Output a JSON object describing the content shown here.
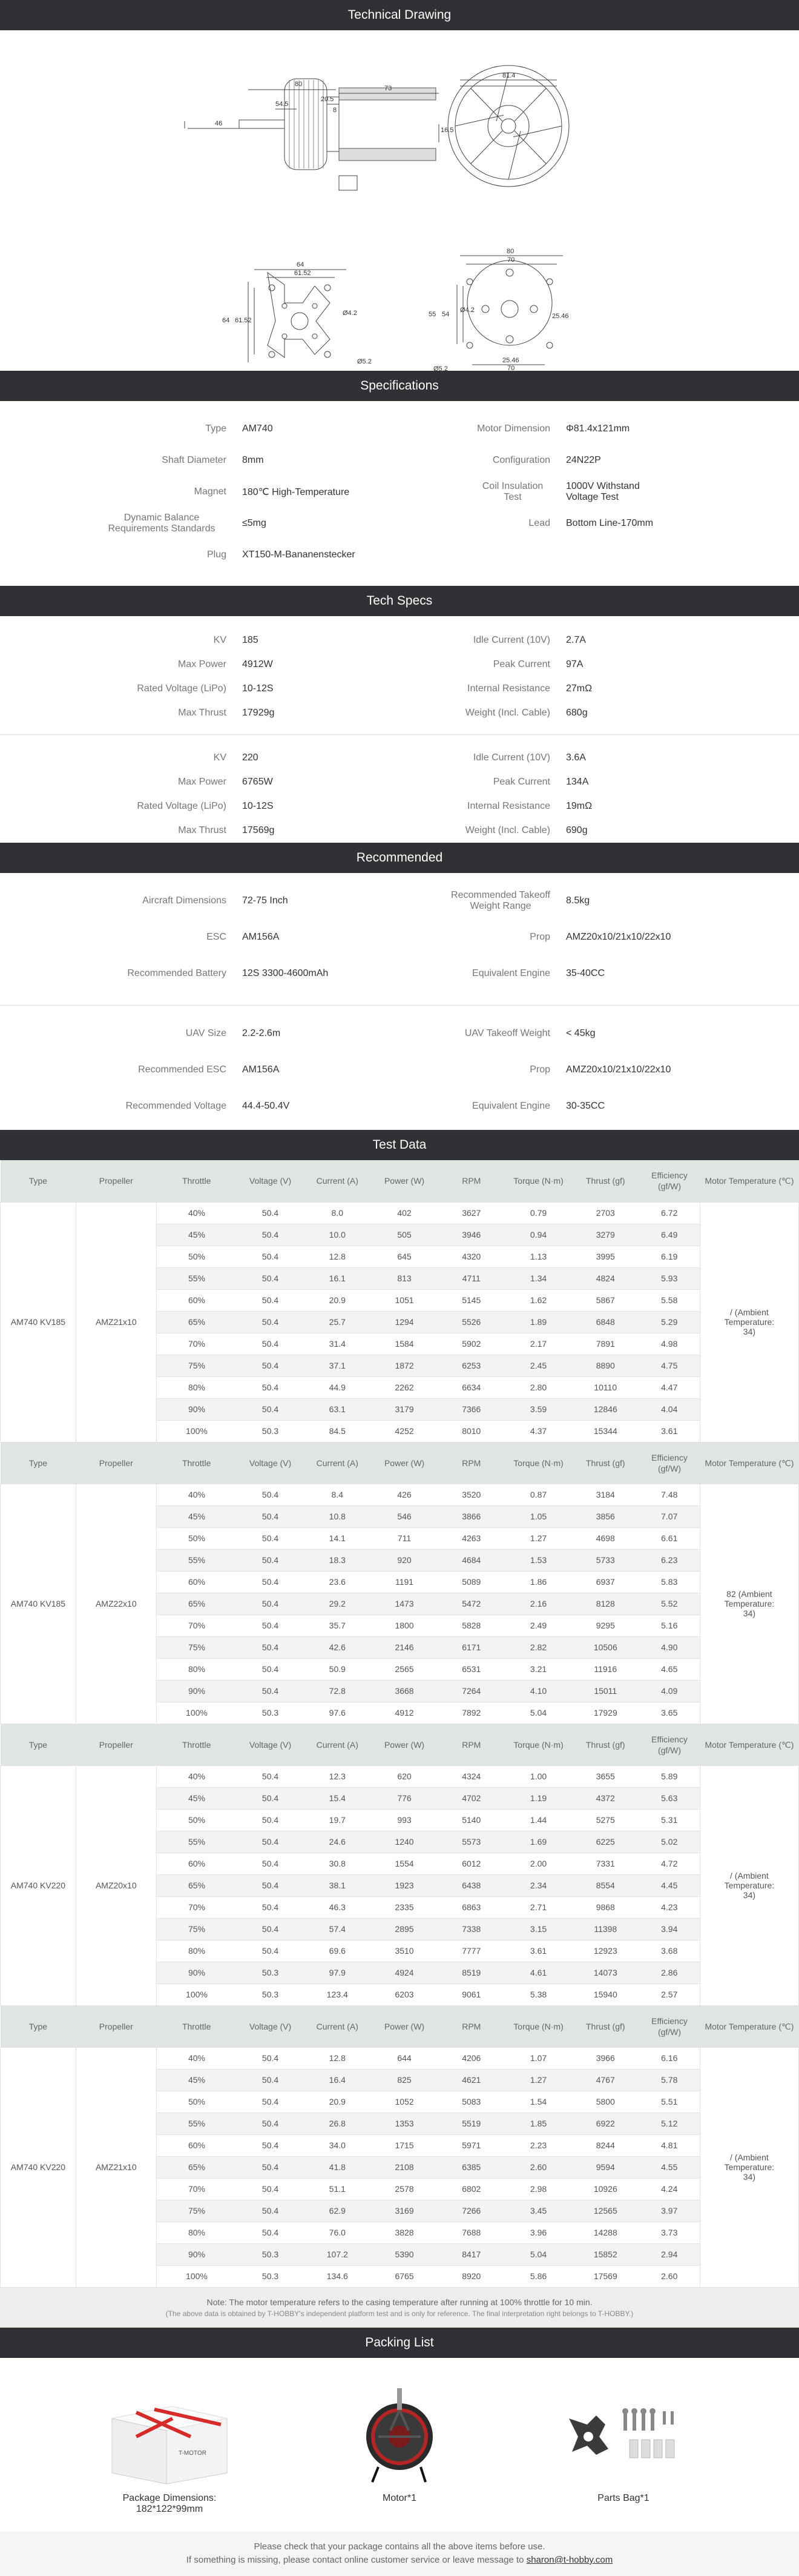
{
  "sections": {
    "technical_drawing": "Technical Drawing",
    "specifications": "Specifications",
    "tech_specs": "Tech Specs",
    "recommended": "Recommended",
    "test_data": "Test Data",
    "packing_list": "Packing List"
  },
  "drawing": {
    "dims": [
      "80",
      "73",
      "54.5",
      "20.5",
      "8",
      "46",
      "16.5",
      "81.4",
      "64",
      "61.52",
      "64",
      "61.52",
      "Ø4.2",
      "Ø5.2",
      "80",
      "70",
      "55",
      "54",
      "Ø4.2",
      "25.46",
      "25.46",
      "70",
      "Ø5.2"
    ]
  },
  "specs": {
    "left": [
      {
        "k": "Type",
        "v": "AM740"
      },
      {
        "k": "Shaft Diameter",
        "v": "8mm"
      },
      {
        "k": "Magnet",
        "v": "180℃ High-Temperature"
      },
      {
        "k": "Dynamic Balance Requirements Standards",
        "v": "≤5mg"
      },
      {
        "k": "Plug",
        "v": "XT150-M-Bananenstecker"
      }
    ],
    "right": [
      {
        "k": "Motor Dimension",
        "v": "Φ81.4x121mm"
      },
      {
        "k": "Configuration",
        "v": "24N22P"
      },
      {
        "k": "Coil Insulation Test",
        "v": "1000V Withstand Voltage Test"
      },
      {
        "k": "Lead",
        "v": "Bottom Line-170mm"
      }
    ]
  },
  "tech_specs": [
    {
      "left": [
        [
          "KV",
          "185"
        ],
        [
          "Max Power",
          "4912W"
        ],
        [
          "Rated Voltage (LiPo)",
          "10-12S"
        ],
        [
          "Max Thrust",
          "17929g"
        ]
      ],
      "right": [
        [
          "Idle Current (10V)",
          "2.7A"
        ],
        [
          "Peak Current",
          "97A"
        ],
        [
          "Internal Resistance",
          "27mΩ"
        ],
        [
          "Weight (Incl. Cable)",
          "680g"
        ]
      ]
    },
    {
      "left": [
        [
          "KV",
          "220"
        ],
        [
          "Max Power",
          "6765W"
        ],
        [
          "Rated Voltage (LiPo)",
          "10-12S"
        ],
        [
          "Max Thrust",
          "17569g"
        ]
      ],
      "right": [
        [
          "Idle Current (10V)",
          "3.6A"
        ],
        [
          "Peak Current",
          "134A"
        ],
        [
          "Internal Resistance",
          "19mΩ"
        ],
        [
          "Weight (Incl. Cable)",
          "690g"
        ]
      ]
    }
  ],
  "recommended": [
    {
      "left": [
        [
          "Aircraft Dimensions",
          "72-75 Inch"
        ],
        [
          "ESC",
          "AM156A"
        ],
        [
          "Recommended Battery",
          "12S 3300-4600mAh"
        ]
      ],
      "right": [
        [
          "Recommended Takeoff Weight Range",
          "8.5kg"
        ],
        [
          "Prop",
          "AMZ20x10/21x10/22x10"
        ],
        [
          "Equivalent Engine",
          "35-40CC"
        ]
      ]
    },
    {
      "left": [
        [
          "UAV Size",
          "2.2-2.6m"
        ],
        [
          "Recommended ESC",
          "AM156A"
        ],
        [
          "Recommended Voltage",
          "44.4-50.4V"
        ]
      ],
      "right": [
        [
          "UAV Takeoff Weight",
          "< 45kg"
        ],
        [
          "Prop",
          "AMZ20x10/21x10/22x10"
        ],
        [
          "Equivalent Engine",
          "30-35CC"
        ]
      ]
    }
  ],
  "test_headers": [
    "Type",
    "Propeller",
    "Throttle",
    "Voltage (V)",
    "Current (A)",
    "Power (W)",
    "RPM",
    "Torque (N·m)",
    "Thrust (gf)",
    "Efficiency (gf/W)",
    "Motor Temperature (℃)"
  ],
  "test_blocks": [
    {
      "type": "AM740 KV185",
      "prop": "AMZ21x10",
      "temp": "/ (Ambient Temperature: 34)",
      "rows": [
        [
          "40%",
          "50.4",
          "8.0",
          "402",
          "3627",
          "0.79",
          "2703",
          "6.72"
        ],
        [
          "45%",
          "50.4",
          "10.0",
          "505",
          "3946",
          "0.94",
          "3279",
          "6.49"
        ],
        [
          "50%",
          "50.4",
          "12.8",
          "645",
          "4320",
          "1.13",
          "3995",
          "6.19"
        ],
        [
          "55%",
          "50.4",
          "16.1",
          "813",
          "4711",
          "1.34",
          "4824",
          "5.93"
        ],
        [
          "60%",
          "50.4",
          "20.9",
          "1051",
          "5145",
          "1.62",
          "5867",
          "5.58"
        ],
        [
          "65%",
          "50.4",
          "25.7",
          "1294",
          "5526",
          "1.89",
          "6848",
          "5.29"
        ],
        [
          "70%",
          "50.4",
          "31.4",
          "1584",
          "5902",
          "2.17",
          "7891",
          "4.98"
        ],
        [
          "75%",
          "50.4",
          "37.1",
          "1872",
          "6253",
          "2.45",
          "8890",
          "4.75"
        ],
        [
          "80%",
          "50.4",
          "44.9",
          "2262",
          "6634",
          "2.80",
          "10110",
          "4.47"
        ],
        [
          "90%",
          "50.4",
          "63.1",
          "3179",
          "7366",
          "3.59",
          "12846",
          "4.04"
        ],
        [
          "100%",
          "50.3",
          "84.5",
          "4252",
          "8010",
          "4.37",
          "15344",
          "3.61"
        ]
      ]
    },
    {
      "type": "AM740 KV185",
      "prop": "AMZ22x10",
      "temp": "82 (Ambient Temperature: 34)",
      "rows": [
        [
          "40%",
          "50.4",
          "8.4",
          "426",
          "3520",
          "0.87",
          "3184",
          "7.48"
        ],
        [
          "45%",
          "50.4",
          "10.8",
          "546",
          "3866",
          "1.05",
          "3856",
          "7.07"
        ],
        [
          "50%",
          "50.4",
          "14.1",
          "711",
          "4263",
          "1.27",
          "4698",
          "6.61"
        ],
        [
          "55%",
          "50.4",
          "18.3",
          "920",
          "4684",
          "1.53",
          "5733",
          "6.23"
        ],
        [
          "60%",
          "50.4",
          "23.6",
          "1191",
          "5089",
          "1.86",
          "6937",
          "5.83"
        ],
        [
          "65%",
          "50.4",
          "29.2",
          "1473",
          "5472",
          "2.16",
          "8128",
          "5.52"
        ],
        [
          "70%",
          "50.4",
          "35.7",
          "1800",
          "5828",
          "2.49",
          "9295",
          "5.16"
        ],
        [
          "75%",
          "50.4",
          "42.6",
          "2146",
          "6171",
          "2.82",
          "10506",
          "4.90"
        ],
        [
          "80%",
          "50.4",
          "50.9",
          "2565",
          "6531",
          "3.21",
          "11916",
          "4.65"
        ],
        [
          "90%",
          "50.4",
          "72.8",
          "3668",
          "7264",
          "4.10",
          "15011",
          "4.09"
        ],
        [
          "100%",
          "50.3",
          "97.6",
          "4912",
          "7892",
          "5.04",
          "17929",
          "3.65"
        ]
      ]
    },
    {
      "type": "AM740 KV220",
      "prop": "AMZ20x10",
      "temp": "/ (Ambient Temperature: 34)",
      "rows": [
        [
          "40%",
          "50.4",
          "12.3",
          "620",
          "4324",
          "1.00",
          "3655",
          "5.89"
        ],
        [
          "45%",
          "50.4",
          "15.4",
          "776",
          "4702",
          "1.19",
          "4372",
          "5.63"
        ],
        [
          "50%",
          "50.4",
          "19.7",
          "993",
          "5140",
          "1.44",
          "5275",
          "5.31"
        ],
        [
          "55%",
          "50.4",
          "24.6",
          "1240",
          "5573",
          "1.69",
          "6225",
          "5.02"
        ],
        [
          "60%",
          "50.4",
          "30.8",
          "1554",
          "6012",
          "2.00",
          "7331",
          "4.72"
        ],
        [
          "65%",
          "50.4",
          "38.1",
          "1923",
          "6438",
          "2.34",
          "8554",
          "4.45"
        ],
        [
          "70%",
          "50.4",
          "46.3",
          "2335",
          "6863",
          "2.71",
          "9868",
          "4.23"
        ],
        [
          "75%",
          "50.4",
          "57.4",
          "2895",
          "7338",
          "3.15",
          "11398",
          "3.94"
        ],
        [
          "80%",
          "50.4",
          "69.6",
          "3510",
          "7777",
          "3.61",
          "12923",
          "3.68"
        ],
        [
          "90%",
          "50.3",
          "97.9",
          "4924",
          "8519",
          "4.61",
          "14073",
          "2.86"
        ],
        [
          "100%",
          "50.3",
          "123.4",
          "6203",
          "9061",
          "5.38",
          "15940",
          "2.57"
        ]
      ]
    },
    {
      "type": "AM740 KV220",
      "prop": "AMZ21x10",
      "temp": "/ (Ambient Temperature: 34)",
      "rows": [
        [
          "40%",
          "50.4",
          "12.8",
          "644",
          "4206",
          "1.07",
          "3966",
          "6.16"
        ],
        [
          "45%",
          "50.4",
          "16.4",
          "825",
          "4621",
          "1.27",
          "4767",
          "5.78"
        ],
        [
          "50%",
          "50.4",
          "20.9",
          "1052",
          "5083",
          "1.54",
          "5800",
          "5.51"
        ],
        [
          "55%",
          "50.4",
          "26.8",
          "1353",
          "5519",
          "1.85",
          "6922",
          "5.12"
        ],
        [
          "60%",
          "50.4",
          "34.0",
          "1715",
          "5971",
          "2.23",
          "8244",
          "4.81"
        ],
        [
          "65%",
          "50.4",
          "41.8",
          "2108",
          "6385",
          "2.60",
          "9594",
          "4.55"
        ],
        [
          "70%",
          "50.4",
          "51.1",
          "2578",
          "6802",
          "2.98",
          "10926",
          "4.24"
        ],
        [
          "75%",
          "50.4",
          "62.9",
          "3169",
          "7266",
          "3.45",
          "12565",
          "3.97"
        ],
        [
          "80%",
          "50.4",
          "76.0",
          "3828",
          "7688",
          "3.96",
          "14288",
          "3.73"
        ],
        [
          "90%",
          "50.3",
          "107.2",
          "5390",
          "8417",
          "5.04",
          "15852",
          "2.94"
        ],
        [
          "100%",
          "50.3",
          "134.6",
          "6765",
          "8920",
          "5.86",
          "17569",
          "2.60"
        ]
      ]
    }
  ],
  "note": {
    "main": "Note: The motor temperature refers to the casing temperature after running at 100% throttle for 10 min.",
    "small": "(The above data is obtained by T-HOBBY's independent platform test and is only for reference. The final interpretation right belongs to T-HOBBY.)"
  },
  "packing": [
    {
      "label": "Package Dimensions: 182*122*99mm"
    },
    {
      "label": "Motor*1"
    },
    {
      "label": "Parts Bag*1"
    }
  ],
  "box_brand": "T-MOTOR",
  "footer": {
    "line1": "Please check that your package contains all the above items before use.",
    "line2": "If something is missing, please contact online customer service or leave message to ",
    "email": "sharon@t-hobby.com"
  }
}
